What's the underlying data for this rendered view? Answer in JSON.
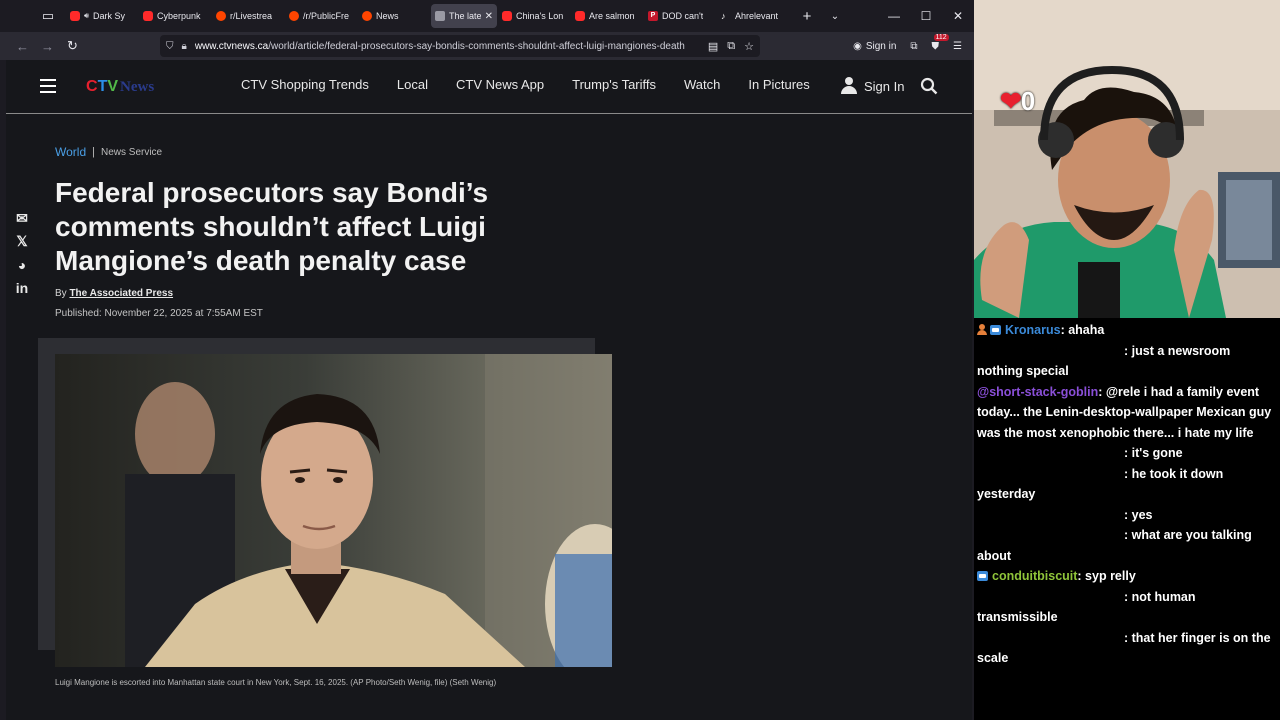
{
  "browser": {
    "tabs": [
      {
        "title": "Dark Sy",
        "favicon": "youtube-icon",
        "audio": true
      },
      {
        "title": "Cyberpunk",
        "favicon": "youtube-icon"
      },
      {
        "title": "r/Livestrea",
        "favicon": "reddit-icon"
      },
      {
        "title": "/r/PublicFre",
        "favicon": "reddit-icon"
      },
      {
        "title": "News",
        "favicon": "reddit-icon"
      },
      {
        "title": "The late",
        "favicon": "ctv-icon",
        "active": true
      },
      {
        "title": "China's Lon",
        "favicon": "youtube-icon"
      },
      {
        "title": "Are salmon",
        "favicon": "youtube-icon"
      },
      {
        "title": "DOD can't",
        "favicon": "p-icon"
      },
      {
        "title": "Ahrelevant",
        "favicon": "tiktok-icon"
      }
    ],
    "url_domain": "www.ctvnews.ca",
    "url_path": "/world/article/federal-prosecutors-say-bondis-comments-shouldnt-affect-luigi-mangiones-death-p",
    "signin_label": "Sign in",
    "extension_badge": "112"
  },
  "site": {
    "logo": {
      "c": "C",
      "t": "T",
      "v": "V",
      "news": "News"
    },
    "nav": [
      "CTV Shopping Trends",
      "Local",
      "CTV News App",
      "Trump's Tariffs",
      "Watch",
      "In Pictures"
    ],
    "signin_label": "Sign In"
  },
  "article": {
    "section": "World",
    "service": "News Service",
    "headline": "Federal prosecutors say Bondi’s comments shouldn’t affect Luigi Mangione’s death penalty case",
    "by_prefix": "By",
    "author": "The Associated Press",
    "published": "Published: November 22, 2025 at 7:55AM EST",
    "caption": "Luigi Mangione is escorted into Manhattan state court in New York, Sept. 16, 2025. (AP Photo/Seth Wenig, file) (Seth Wenig)"
  },
  "stream": {
    "counter": "0"
  },
  "chat": [
    {
      "user": "Kronarus",
      "user_color": "#3b8ad9",
      "badges": [
        "person",
        "sub"
      ],
      "text": ": ahaha"
    },
    {
      "user": "",
      "indent": true,
      "text": ": just a newsroom nothing special"
    },
    {
      "user": "@short-stack-goblin",
      "user_color": "#8a4fd8",
      "badges": [],
      "text": ": @rele i had a family event today... the Lenin-desktop-wallpaper Mexican guy was the most xenophobic there... i hate my life"
    },
    {
      "user": "",
      "indent": true,
      "text": ": it's gone"
    },
    {
      "user": "",
      "indent": true,
      "text": ": he took it down yesterday"
    },
    {
      "user": "",
      "indent": true,
      "text": ": yes"
    },
    {
      "user": "",
      "indent": true,
      "text": ": what are you talking about"
    },
    {
      "user": "conduitbiscuit",
      "user_color": "#8fc43a",
      "badges": [
        "sub"
      ],
      "text": ": syp relly"
    },
    {
      "user": "",
      "indent": true,
      "text": ": not human transmissible"
    },
    {
      "user": "",
      "indent": true,
      "text": ": that her finger is on the scale"
    }
  ]
}
